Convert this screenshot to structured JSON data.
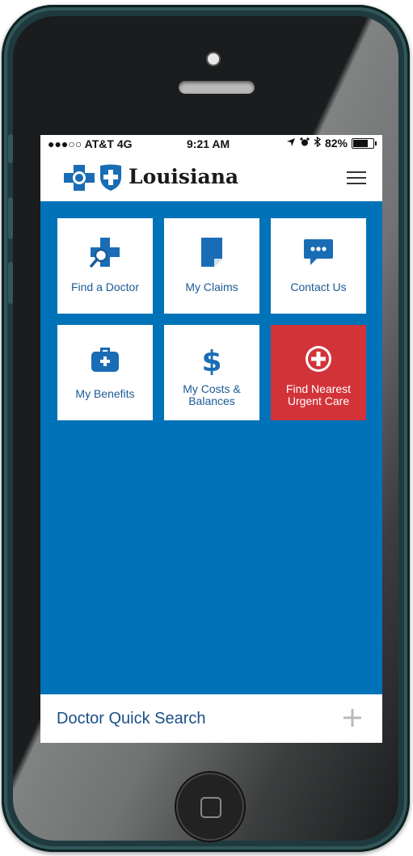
{
  "status_bar": {
    "carrier": "●●●○○ AT&T  4G",
    "time": "9:21 AM",
    "battery": "82%",
    "battery_level": 0.82
  },
  "header": {
    "brand": "Louisiana"
  },
  "tiles": [
    {
      "label": "Find a Doctor",
      "icon": "find-doctor-icon"
    },
    {
      "label": "My Claims",
      "icon": "document-icon"
    },
    {
      "label": "Contact Us",
      "icon": "chat-icon"
    },
    {
      "label": "My Benefits",
      "icon": "medical-bag-icon"
    },
    {
      "label": "My Costs & Balances",
      "icon": "dollar-icon"
    },
    {
      "label": "Find Nearest Urgent Care",
      "icon": "plus-circle-icon"
    }
  ],
  "quick_search": {
    "label": "Doctor Quick Search"
  },
  "colors": {
    "screen_bg": "#0072b8",
    "tile_text": "#1a5a96",
    "urgent_care_bg": "#d23339",
    "logo_blue": "#1a6db5"
  }
}
